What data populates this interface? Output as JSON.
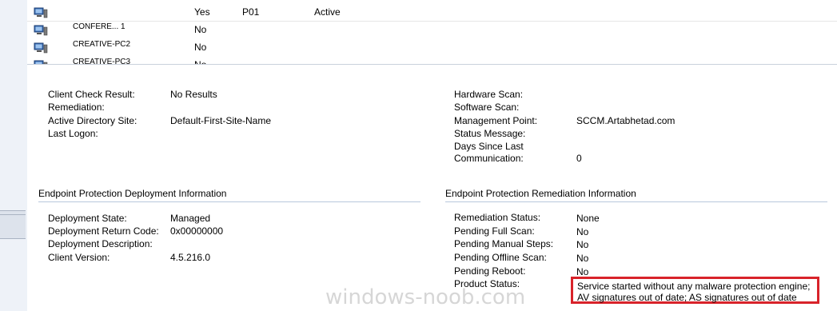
{
  "devices": [
    {
      "name": "",
      "client": "Yes",
      "site": "P01",
      "status": "Active"
    },
    {
      "name": "CONFERE... 1",
      "client": "No",
      "site": "",
      "status": ""
    },
    {
      "name": "CREATIVE-PC2",
      "client": "No",
      "site": "",
      "status": ""
    },
    {
      "name": "CREATIVE-PC3",
      "client": "No",
      "site": "",
      "status": ""
    }
  ],
  "details": {
    "clipped_heading": "",
    "left_top": [
      {
        "label": "Client Check Result:",
        "value": "No Results"
      },
      {
        "label": "Remediation:",
        "value": ""
      },
      {
        "label": "Active Directory Site:",
        "value": "Default-First-Site-Name"
      },
      {
        "label": "Last Logon:",
        "value": ""
      }
    ],
    "right_top": [
      {
        "label": "Hardware Scan:",
        "value": ""
      },
      {
        "label": "Software Scan:",
        "value": ""
      },
      {
        "label": "Management Point:",
        "value": "SCCM.Artabhetad.com"
      },
      {
        "label": "Status Message:",
        "value": ""
      },
      {
        "label": "Days Since Last",
        "value": ""
      },
      {
        "label": "Communication:",
        "value": "0"
      }
    ],
    "deployment": {
      "title": "Endpoint Protection Deployment Information",
      "rows": [
        {
          "label": "Deployment State:",
          "value": "Managed"
        },
        {
          "label": "Deployment Return Code:",
          "value": "0x00000000"
        },
        {
          "label": "Deployment Description:",
          "value": ""
        },
        {
          "label": "Client Version:",
          "value": "4.5.216.0"
        }
      ]
    },
    "remediation": {
      "title": "Endpoint Protection Remediation Information",
      "rows": [
        {
          "label": "Remediation Status:",
          "value": "None"
        },
        {
          "label": "Pending Full Scan:",
          "value": "No"
        },
        {
          "label": "Pending Manual Steps:",
          "value": "No"
        },
        {
          "label": "Pending Offline Scan:",
          "value": "No"
        },
        {
          "label": "Pending Reboot:",
          "value": "No"
        }
      ],
      "product_status_label": "Product Status:",
      "product_status_line1": "Service started without any malware protection engine;",
      "product_status_line2": "AV signatures out of date; AS signatures out of date"
    }
  },
  "watermark": "windows-noob.com",
  "colors": {
    "highlight_border": "#d8232a",
    "section_rule": "#b8c7dc"
  }
}
